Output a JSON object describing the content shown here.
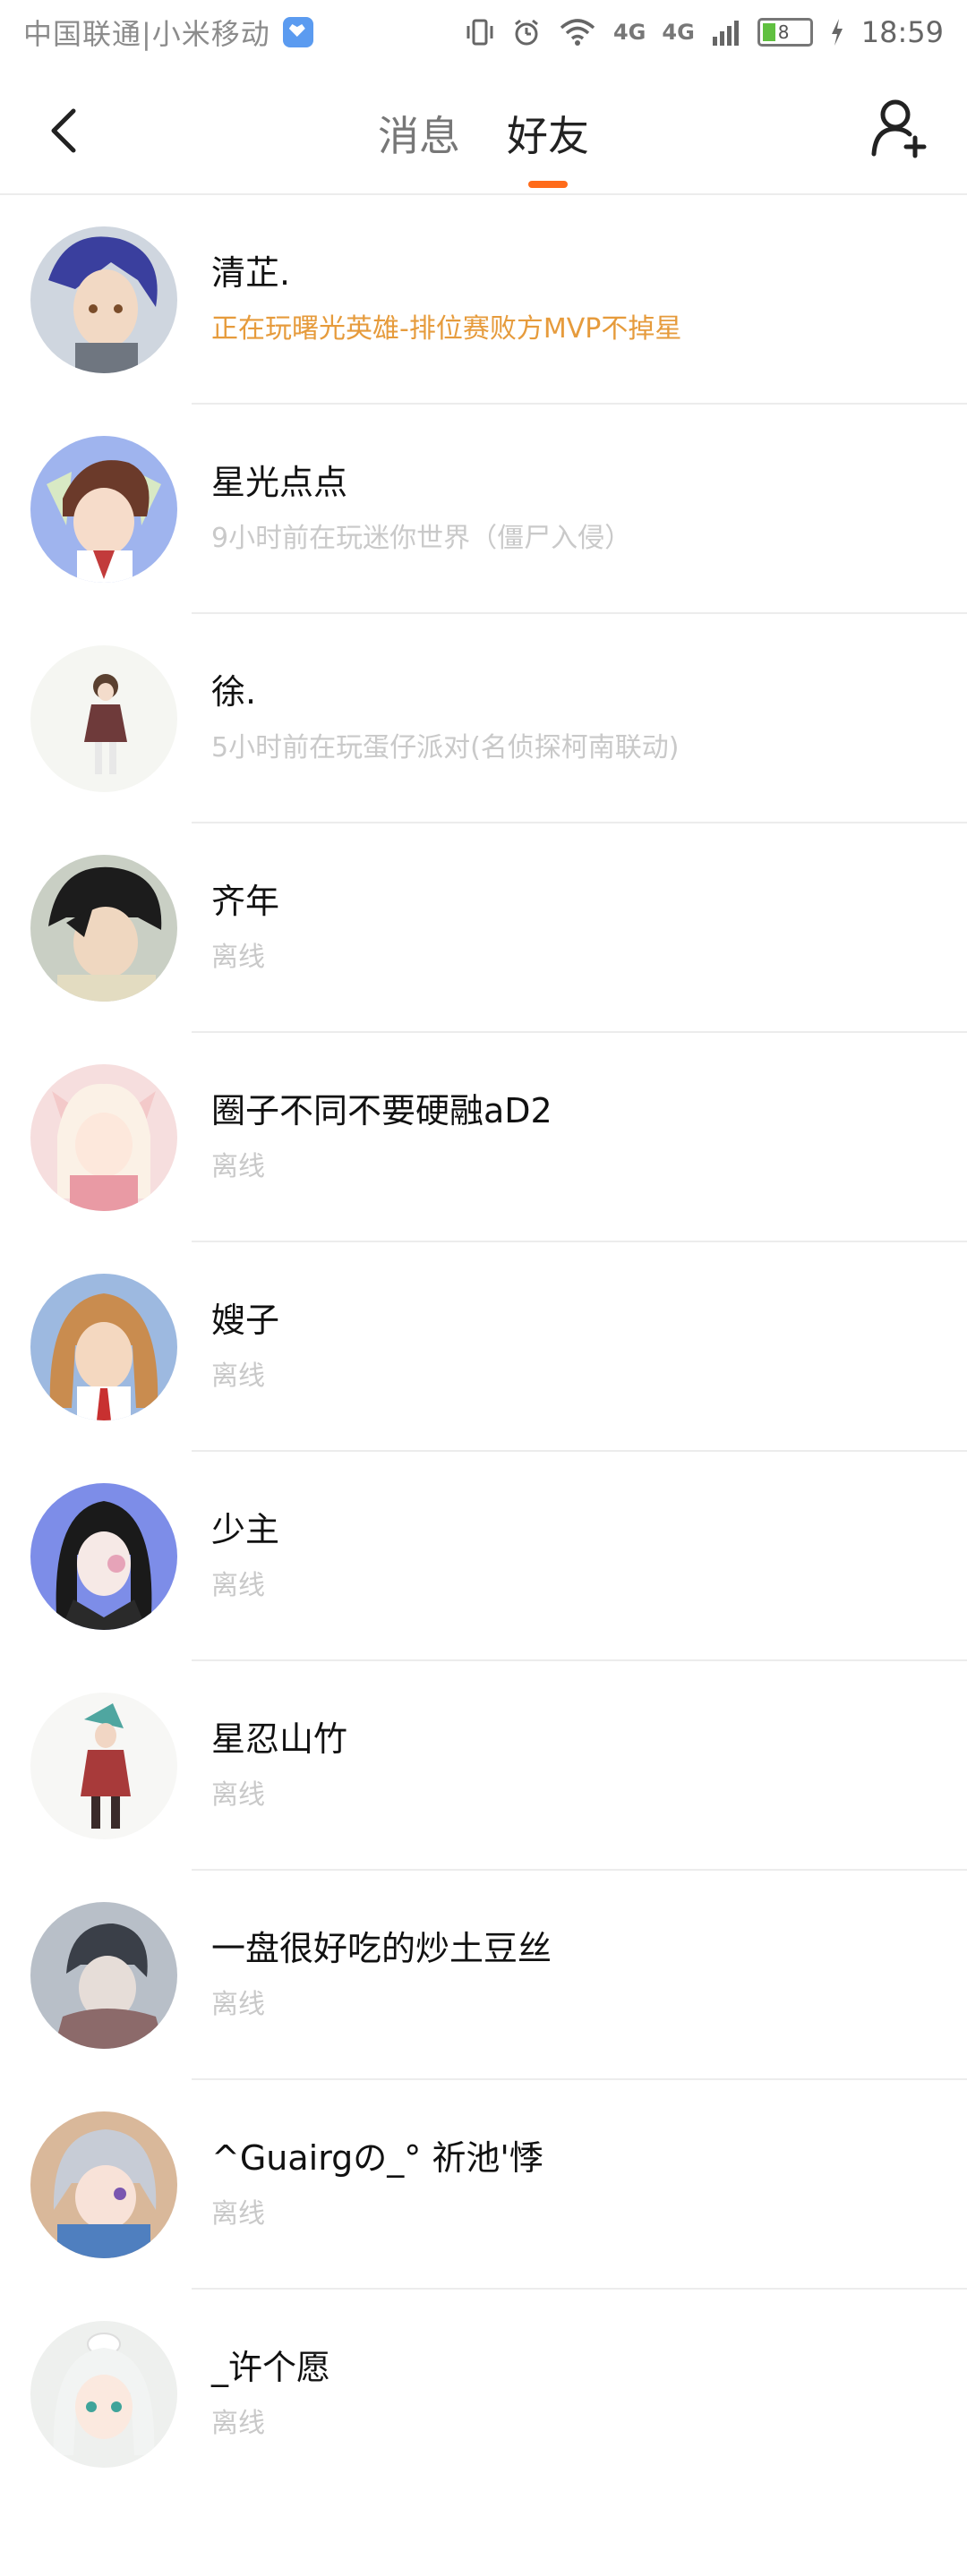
{
  "status_bar": {
    "carrier": "中国联通|小米移动",
    "network_a": "4G",
    "network_b": "4G",
    "battery_level": "8",
    "time": "18:59",
    "icons": [
      "vibrate-icon",
      "alarm-icon",
      "wifi-icon",
      "signal-icon",
      "battery-icon",
      "charging-icon"
    ]
  },
  "nav": {
    "back_icon": "chevron-left-icon",
    "tabs": [
      {
        "label": "消息",
        "active": false
      },
      {
        "label": "好友",
        "active": true
      }
    ],
    "add_friend_icon": "add-person-icon",
    "accent_color": "#ff6b1a"
  },
  "friends": [
    {
      "name": "清芷.",
      "status": "正在玩曙光英雄-排位赛败方MVP不掉星",
      "online": true
    },
    {
      "name": "星光点点",
      "status": "9小时前在玩迷你世界（僵尸入侵）",
      "online": false
    },
    {
      "name": "徐.",
      "status": "5小时前在玩蛋仔派对(名侦探柯南联动)",
      "online": false
    },
    {
      "name": "齐年",
      "status": "离线",
      "online": false
    },
    {
      "name": "圈子不同不要硬融aD2",
      "status": "离线",
      "online": false
    },
    {
      "name": "嫂子",
      "status": "离线",
      "online": false
    },
    {
      "name": "少主",
      "status": "离线",
      "online": false
    },
    {
      "name": "星忍山竹",
      "status": "离线",
      "online": false
    },
    {
      "name": "一盘很好吃的炒土豆丝",
      "status": "离线",
      "online": false
    },
    {
      "name": "^Guairgの_°  祈池'悸",
      "status": "离线",
      "online": false
    },
    {
      "name": "_许个愿",
      "status": "离线",
      "online": false
    }
  ],
  "colors": {
    "online_status": "#e69b3c",
    "offline_status": "#c9c9c9",
    "divider": "#ececec"
  }
}
